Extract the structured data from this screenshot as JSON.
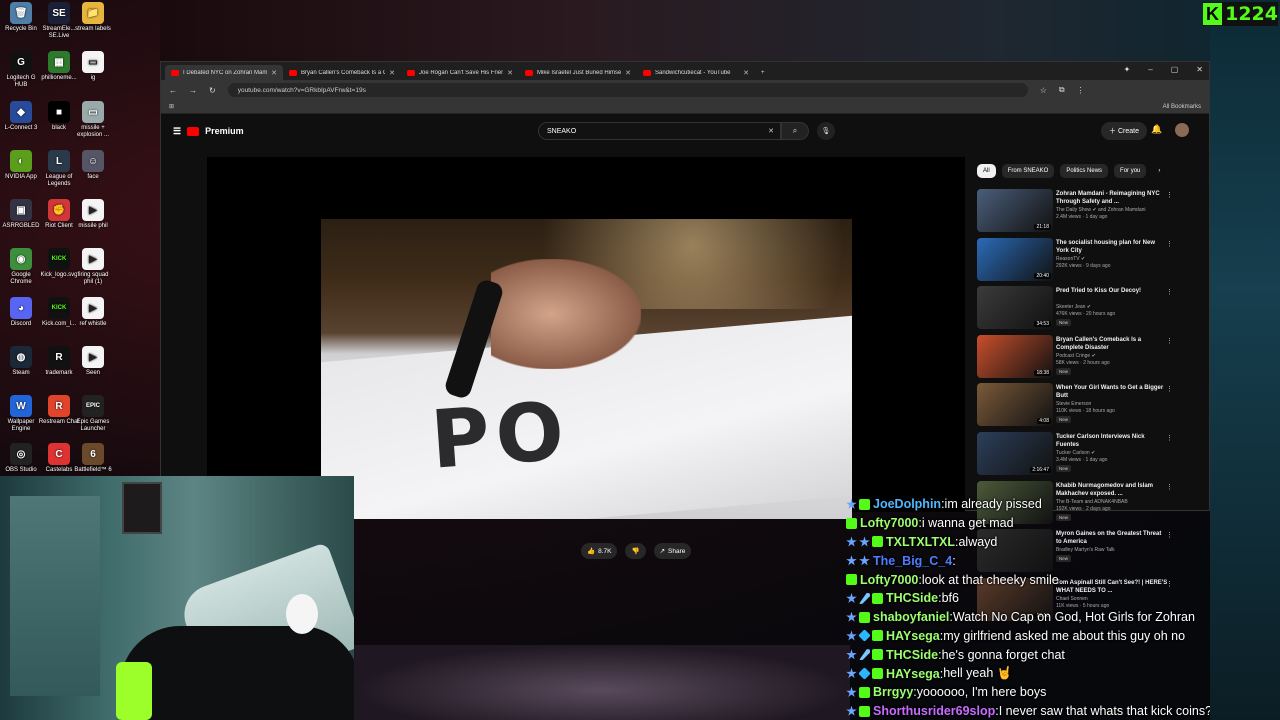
{
  "kick": {
    "logo": "K",
    "count": "1224"
  },
  "desktop_icons": [
    {
      "label": "Recycle Bin",
      "glyph": "🗑",
      "color": "#4f7ea8"
    },
    {
      "label": "StreamEle... SE.Live",
      "glyph": "SE",
      "color": "#1b2038"
    },
    {
      "label": "stream labels",
      "glyph": "📁",
      "color": "#e7b73d"
    },
    {
      "label": "Logitech G HUB",
      "glyph": "G",
      "color": "#111"
    },
    {
      "label": "phillioneme...",
      "glyph": "▦",
      "color": "#2d7a2d"
    },
    {
      "label": "ig",
      "glyph": "▭",
      "color": "#f4f4f4"
    },
    {
      "label": "L-Connect 3",
      "glyph": "◆",
      "color": "#274b9a"
    },
    {
      "label": "black",
      "glyph": "■",
      "color": "#000"
    },
    {
      "label": "missile + explosion ...",
      "glyph": "▭",
      "color": "#9aa"
    },
    {
      "label": "NVIDIA App",
      "glyph": "◐",
      "color": "#5a9e1b"
    },
    {
      "label": "League of Legends",
      "glyph": "L",
      "color": "#2a3a4a"
    },
    {
      "label": "face",
      "glyph": "☺",
      "color": "#556"
    },
    {
      "label": "ASRRGBLED",
      "glyph": "▣",
      "color": "#334"
    },
    {
      "label": "Riot Client",
      "glyph": "✊",
      "color": "#d13639"
    },
    {
      "label": "missile phil",
      "glyph": "▶",
      "color": "#f4f4f4"
    },
    {
      "label": "Google Chrome",
      "glyph": "◉",
      "color": "#3d8f3d"
    },
    {
      "label": "Kick_logo.svg",
      "glyph": "KICK",
      "color": "#111"
    },
    {
      "label": "firing squad phil (1)",
      "glyph": "▶",
      "color": "#f4f4f4"
    },
    {
      "label": "Discord",
      "glyph": "◕",
      "color": "#5865f2"
    },
    {
      "label": "Kick.com_l...",
      "glyph": "KICK",
      "color": "#111"
    },
    {
      "label": "ref whistle",
      "glyph": "▶",
      "color": "#f4f4f4"
    },
    {
      "label": "Steam",
      "glyph": "◍",
      "color": "#1b2838"
    },
    {
      "label": "trademark",
      "glyph": "R",
      "color": "#111"
    },
    {
      "label": "Seen",
      "glyph": "▶",
      "color": "#f4f4f4"
    },
    {
      "label": "Wallpaper Engine",
      "glyph": "W",
      "color": "#2265d8"
    },
    {
      "label": "Restream Chat",
      "glyph": "R",
      "color": "#e0452c"
    },
    {
      "label": "Epic Games Launcher",
      "glyph": "EPIC",
      "color": "#222"
    },
    {
      "label": "OBS Studio",
      "glyph": "◎",
      "color": "#222"
    },
    {
      "label": "Castelabs",
      "glyph": "C",
      "color": "#d33"
    },
    {
      "label": "Battlefield™ 6",
      "glyph": "6",
      "color": "#6b4a2b"
    }
  ],
  "browser": {
    "tabs": [
      {
        "label": "I Debated NYC on Zohran Mamdani"
      },
      {
        "label": "Bryan Callen's Comeback Is a C"
      },
      {
        "label": "Joe Rogan Can't Save His Frien"
      },
      {
        "label": "Mike Israetel Just Buried Himse"
      },
      {
        "label": "Sandwichcutiecat - YouTube"
      }
    ],
    "url": "youtube.com/watch?v=GRkbIpAVFrw&t=19s",
    "bookmarks_label": "All Bookmarks"
  },
  "youtube": {
    "brand": "Premium",
    "search_value": "SNEAKO",
    "create_label": "Create",
    "filters": [
      "All",
      "From SNEAKO",
      "Politics News",
      "For you"
    ],
    "like_count": "8.7K",
    "share_label": "Share",
    "recommendations": [
      {
        "title": "Zohran Mamdani - Reimagining NYC Through Safety and ...",
        "channel": "The Daily Show ✔ and Zohran Mamdani",
        "views": "2.4M views · 1 day ago",
        "dur": "21:18",
        "thumb": "#4a5e7a",
        "new": false
      },
      {
        "title": "The socialist housing plan for New York City",
        "channel": "ReasonTV ✔",
        "views": "292K views · 9 days ago",
        "dur": "20:40",
        "thumb": "#2a6bb8",
        "new": false
      },
      {
        "title": "Pred Tried to Kiss Our Decoy!",
        "channel": "Skeeter Jean ✔",
        "views": "476K views · 20 hours ago",
        "dur": "34:53",
        "thumb": "#3b3b3b",
        "new": true
      },
      {
        "title": "Bryan Callen's Comeback Is a Complete Disaster",
        "channel": "Podcast Cringe ✔",
        "views": "58K views · 2 hours ago",
        "dur": "18:38",
        "thumb": "#c94f2c",
        "new": true
      },
      {
        "title": "When Your Girl Wants to Get a Bigger Butt",
        "channel": "Stevie Emerson",
        "views": "110K views · 18 hours ago",
        "dur": "4:08",
        "thumb": "#7a5a3a",
        "new": true
      },
      {
        "title": "Tucker Carlson Interviews Nick Fuentes",
        "channel": "Tucker Carlson ✔",
        "views": "3.4M views · 1 day ago",
        "dur": "2:16:47",
        "thumb": "#2c3f5a",
        "new": true
      },
      {
        "title": "Khabib Nurmagomedov and Islam Makhachev exposed. ...",
        "channel": "The B-Team and ADNAK4NBAB",
        "views": "192K views · 2 days ago",
        "dur": "",
        "thumb": "#4b5a3a",
        "new": true
      },
      {
        "title": "Myron Gaines on the Greatest Threat to America",
        "channel": "Bradley Martyn's Raw Talk",
        "views": "",
        "dur": "",
        "thumb": "#2b2b2b",
        "new": true
      },
      {
        "title": "Tom Aspinall Still Can't See?! | HERE'S WHAT NEEDS TO ...",
        "channel": "Chael Sonnen",
        "views": "11K views · 5 hours ago",
        "dur": "12:10",
        "thumb": "#5a3a2a",
        "new": false
      }
    ]
  },
  "chat": [
    {
      "user": "JoeDolphin",
      "color": "#4fb8ff",
      "text": "im already pissed",
      "badges": [
        "star",
        "kick"
      ]
    },
    {
      "user": "Lofty7000",
      "color": "#9cff6f",
      "text": "i wanna get mad",
      "badges": [
        "kick"
      ]
    },
    {
      "user": "TXLTXLTXL",
      "color": "#9cff6f",
      "text": "alwayd",
      "badges": [
        "star",
        "star",
        "kick"
      ]
    },
    {
      "user": "The_Big_C_4",
      "color": "#4f7dff",
      "text": "",
      "badges": [
        "star",
        "star"
      ]
    },
    {
      "user": "Lofty7000",
      "color": "#9cff6f",
      "text": "look at that cheeky smile",
      "badges": [
        "kick"
      ]
    },
    {
      "user": "THCSide",
      "color": "#9cff6f",
      "text": "bf6",
      "badges": [
        "star",
        "sword",
        "kick"
      ]
    },
    {
      "user": "shaboyfaniel",
      "color": "#9cff6f",
      "text": "Watch No Cap on God, Hot Girls for Zohran",
      "badges": [
        "star",
        "kick"
      ]
    },
    {
      "user": "HAYsega",
      "color": "#9cff6f",
      "text": "my girlfriend asked me about this guy oh no",
      "badges": [
        "star",
        "gem",
        "kick"
      ]
    },
    {
      "user": "THCSide",
      "color": "#9cff6f",
      "text": "he's gonna forget chat",
      "badges": [
        "star",
        "sword",
        "kick"
      ]
    },
    {
      "user": "HAYsega",
      "color": "#9cff6f",
      "text": "hell yeah 🤘",
      "badges": [
        "star",
        "gem",
        "kick"
      ]
    },
    {
      "user": "Brrgyy",
      "color": "#9cff6f",
      "text": "yoooooo, I'm here boys",
      "badges": [
        "star",
        "kick"
      ]
    },
    {
      "user": "Shorthusrider69slop",
      "color": "#c86bff",
      "text": "I never saw that whats that kick coins?",
      "badges": [
        "star",
        "kick"
      ]
    }
  ]
}
